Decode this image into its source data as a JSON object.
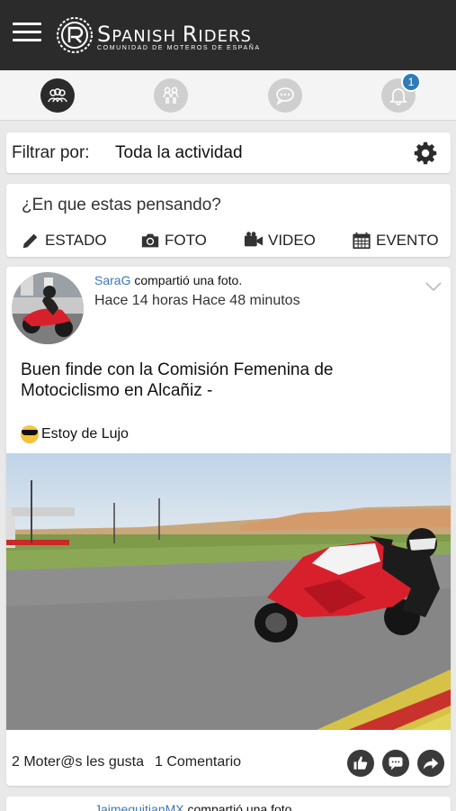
{
  "header": {
    "brand_first": "S",
    "brand_mid": "PANISH ",
    "brand_second": "R",
    "brand_rest": "IDERS",
    "tagline": "COMUNIDAD DE MOTEROS DE ESPAÑA"
  },
  "tabs": [
    {
      "icon": "community-icon",
      "active": true
    },
    {
      "icon": "friends-icon",
      "active": false
    },
    {
      "icon": "chat-icon",
      "active": false
    },
    {
      "icon": "bell-icon",
      "active": false,
      "badge": "1"
    }
  ],
  "filter": {
    "label": "Filtrar por:",
    "value": "Toda la actividad"
  },
  "composer": {
    "prompt": "¿En que estas pensando?",
    "actions": [
      "ESTADO",
      "FOTO",
      "VIDEO",
      "EVENTO"
    ]
  },
  "post": {
    "author": "SaraG",
    "action_text": " compartió una foto.",
    "timestamp": "Hace 14 horas Hace 48 minutos",
    "text": "Buen finde con la Comisión Femenina de Motociclismo en Alcañiz -",
    "feeling": "Estoy de Lujo",
    "likes": "2 Moter@s les gusta",
    "comments": "1 Comentario"
  },
  "next_post": {
    "author": "JaimequitianMX",
    "action_text": " compartió una foto."
  },
  "colors": {
    "header_bg": "#2b2b2b",
    "link_blue": "#3a78b5",
    "badge_blue": "#2e7bb8",
    "moto_red": "#d8202c"
  }
}
